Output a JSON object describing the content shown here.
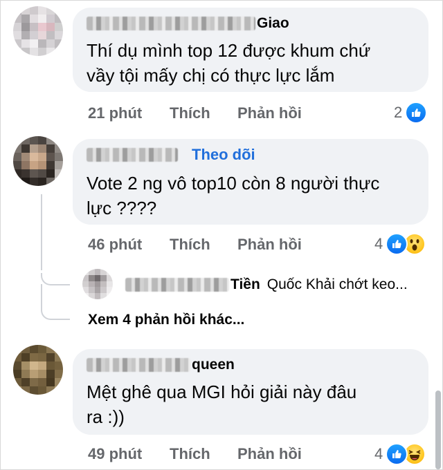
{
  "comments": [
    {
      "author_suffix": "Giao",
      "text": "Thí dụ mình top 12 được khum chứ\nvầy tội mấy chị có thực lực lắm",
      "time": "21 phút",
      "like_label": "Thích",
      "reply_label": "Phản hồi",
      "reaction_count": "2",
      "reactions": [
        "like-icon"
      ]
    },
    {
      "author_suffix": "",
      "follow_label": "Theo dõi",
      "text": "Vote 2 ng vô top10 còn 8 người thực\nlực ????",
      "time": "46 phút",
      "like_label": "Thích",
      "reply_label": "Phản hồi",
      "reaction_count": "4",
      "reactions": [
        "like-icon",
        "wow-icon"
      ]
    },
    {
      "author_suffix": "queen",
      "text": "Mệt ghê qua MGI hỏi giải này đâu\nra :))",
      "time": "49 phút",
      "like_label": "Thích",
      "reply_label": "Phản hồi",
      "reaction_count": "4",
      "reactions": [
        "like-icon",
        "haha-icon"
      ]
    }
  ],
  "reply_preview": {
    "author_suffix": "Tiền",
    "text": "Quốc Khải  chớt keo..."
  },
  "view_more_label": "Xem 4 phản hồi khác...",
  "colors": {
    "bubble": "#f0f2f5",
    "meta_text": "#65676b",
    "link_blue": "#216fdb",
    "like_blue": "#0a6bf0"
  }
}
